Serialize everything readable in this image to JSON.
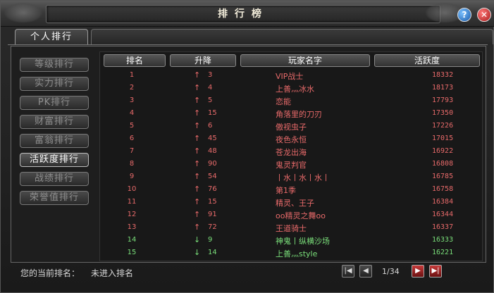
{
  "window": {
    "title": "排行榜",
    "help_label": "?",
    "close_label": "✕"
  },
  "tabs": [
    {
      "label": "个人排行",
      "active": true
    }
  ],
  "sidebar": {
    "items": [
      {
        "label": "等级排行",
        "active": false
      },
      {
        "label": "实力排行",
        "active": false
      },
      {
        "label": "PK排行",
        "active": false
      },
      {
        "label": "财富排行",
        "active": false
      },
      {
        "label": "富翁排行",
        "active": false
      },
      {
        "label": "活跃度排行",
        "active": true
      },
      {
        "label": "战绩排行",
        "active": false
      },
      {
        "label": "荣誉值排行",
        "active": false
      }
    ]
  },
  "table": {
    "columns": [
      "排名",
      "升降",
      "玩家名字",
      "活跃度"
    ],
    "rows": [
      {
        "rank": "1",
        "dir": "up",
        "arrow": "↑",
        "change": "3",
        "name": "VIP战士",
        "activity": "18332"
      },
      {
        "rank": "2",
        "dir": "up",
        "arrow": "↑",
        "change": "4",
        "name": "上善灬冰水",
        "activity": "18173"
      },
      {
        "rank": "3",
        "dir": "up",
        "arrow": "↑",
        "change": "5",
        "name": "恋能",
        "activity": "17793"
      },
      {
        "rank": "4",
        "dir": "up",
        "arrow": "↑",
        "change": "15",
        "name": "角落里的刀刃",
        "activity": "17350"
      },
      {
        "rank": "5",
        "dir": "up",
        "arrow": "↑",
        "change": "6",
        "name": "傲视虫子",
        "activity": "17226"
      },
      {
        "rank": "6",
        "dir": "up",
        "arrow": "↑",
        "change": "45",
        "name": "夜色永恒",
        "activity": "17015"
      },
      {
        "rank": "7",
        "dir": "up",
        "arrow": "↑",
        "change": "48",
        "name": "苍龙出海",
        "activity": "16922"
      },
      {
        "rank": "8",
        "dir": "up",
        "arrow": "↑",
        "change": "90",
        "name": "鬼灵判官",
        "activity": "16808"
      },
      {
        "rank": "9",
        "dir": "up",
        "arrow": "↑",
        "change": "54",
        "name": "丨水丨水丨水丨",
        "activity": "16785"
      },
      {
        "rank": "10",
        "dir": "up",
        "arrow": "↑",
        "change": "76",
        "name": "第1季",
        "activity": "16758"
      },
      {
        "rank": "11",
        "dir": "up",
        "arrow": "↑",
        "change": "15",
        "name": "精灵、王子",
        "activity": "16384"
      },
      {
        "rank": "12",
        "dir": "up",
        "arrow": "↑",
        "change": "91",
        "name": "oo精灵之舞oo",
        "activity": "16344"
      },
      {
        "rank": "13",
        "dir": "up",
        "arrow": "↑",
        "change": "72",
        "name": "王道骑士",
        "activity": "16337"
      },
      {
        "rank": "14",
        "dir": "down",
        "arrow": "↓",
        "change": "9",
        "name": "神鬼丨纵横沙场",
        "activity": "16333"
      },
      {
        "rank": "15",
        "dir": "down",
        "arrow": "↓",
        "change": "14",
        "name": "上善灬style",
        "activity": "16221"
      }
    ]
  },
  "footer": {
    "current_rank_label": "您的当前排名：",
    "current_rank_value": "未进入排名",
    "page_indicator": "1/34",
    "first_label": "|◀",
    "prev_label": "◀",
    "next_label": "▶",
    "last_label": "▶|"
  },
  "colors": {
    "rising": "#e86a6a",
    "falling": "#7adf7a"
  }
}
